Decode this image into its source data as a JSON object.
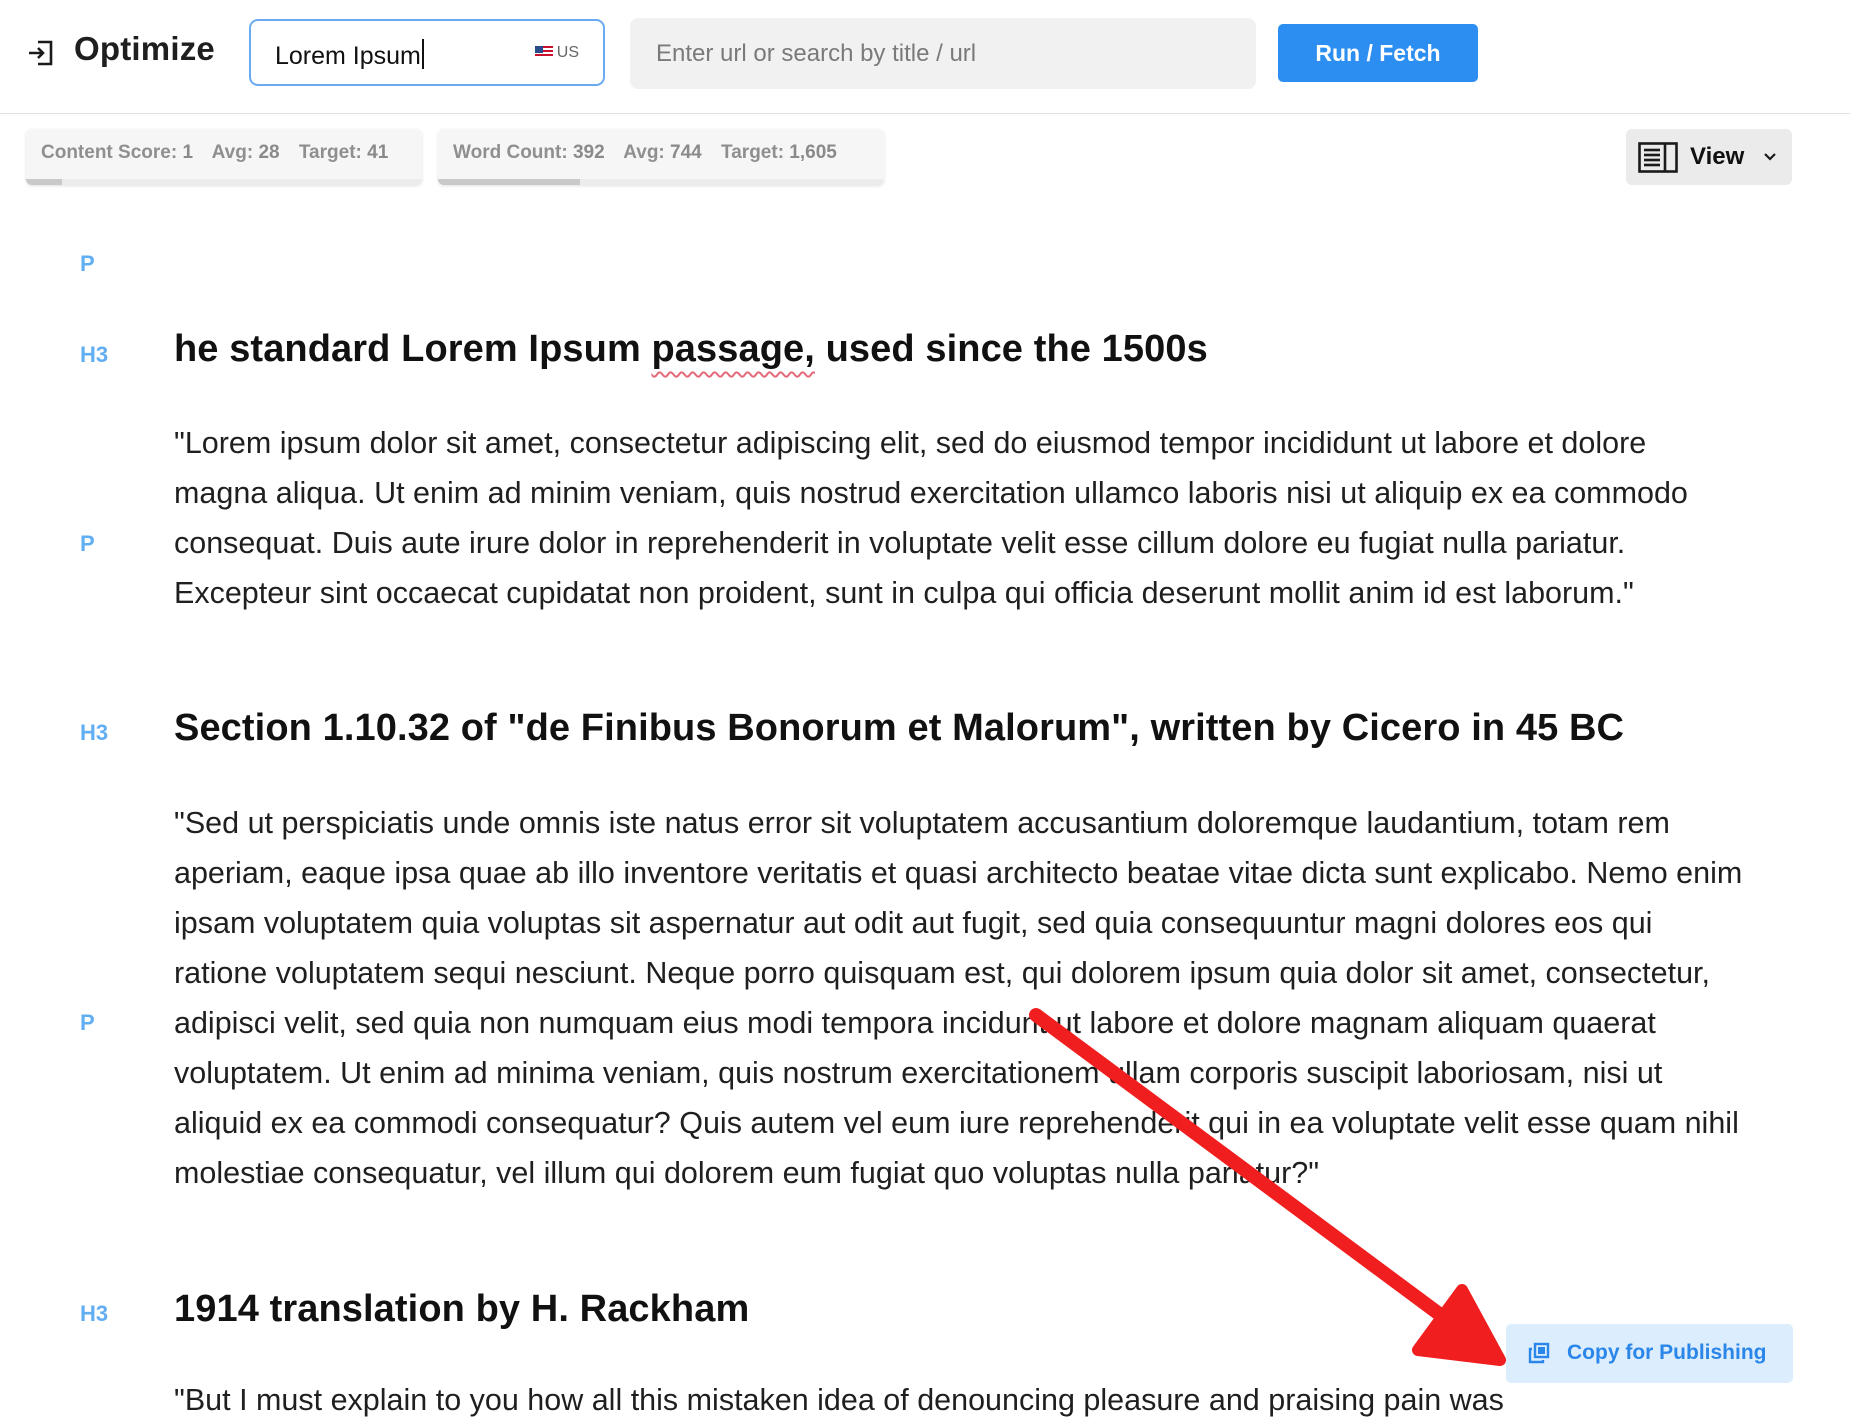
{
  "header": {
    "title": "Optimize",
    "keyword_value": "Lorem Ipsum",
    "locale": "US",
    "url_placeholder": "Enter url or search by title / url",
    "run_label": "Run / Fetch"
  },
  "metrics": {
    "content_score": {
      "label": "Content Score:",
      "value": "1",
      "avg_label": "Avg:",
      "avg": "28",
      "target_label": "Target:",
      "target": "41"
    },
    "word_count": {
      "label": "Word Count:",
      "value": "392",
      "avg_label": "Avg:",
      "avg": "744",
      "target_label": "Target:",
      "target": "1,605"
    },
    "view_label": "View"
  },
  "editor": {
    "blocks": [
      {
        "tag": "P",
        "text": ""
      },
      {
        "tag": "H3",
        "text_before": "he standard Lorem Ipsum ",
        "misspelled": "passage,",
        "text_after": " used since the 1500s"
      },
      {
        "tag": "P",
        "text": "\"Lorem ipsum dolor sit amet, consectetur adipiscing elit, sed do eiusmod tempor incididunt ut labore et dolore magna aliqua. Ut enim ad minim veniam, quis nostrud exercitation ullamco laboris nisi ut aliquip ex ea commodo consequat. Duis aute irure dolor in reprehenderit in voluptate velit esse cillum dolore eu fugiat nulla pariatur. Excepteur sint occaecat cupidatat non proident, sunt in culpa qui officia deserunt mollit anim id est laborum.\""
      },
      {
        "tag": "H3",
        "text": "Section 1.10.32 of \"de Finibus Bonorum et Malorum\", written by Cicero in 45 BC"
      },
      {
        "tag": "P",
        "text": "\"Sed ut perspiciatis unde omnis iste natus error sit voluptatem accusantium doloremque laudantium, totam rem aperiam, eaque ipsa quae ab illo inventore veritatis et quasi architecto beatae vitae dicta sunt explicabo. Nemo enim ipsam voluptatem quia voluptas sit aspernatur aut odit aut fugit, sed quia consequuntur magni dolores eos qui ratione voluptatem sequi nesciunt. Neque porro quisquam est, qui dolorem ipsum quia dolor sit amet, consectetur, adipisci velit, sed quia non numquam eius modi tempora incidunt ut labore et dolore magnam aliquam quaerat voluptatem. Ut enim ad minima veniam, quis nostrum exercitationem ullam corporis suscipit laboriosam, nisi ut aliquid ex ea commodi consequatur? Quis autem vel eum iure reprehenderit qui in ea voluptate velit esse quam nihil molestiae consequatur, vel illum qui dolorem eum fugiat quo voluptas nulla pariatur?\""
      },
      {
        "tag": "H3",
        "text": "1914 translation by H. Rackham"
      },
      {
        "tag": "P",
        "text": "\"But I must explain to you how all this mistaken idea of denouncing pleasure and praising pain was"
      }
    ]
  },
  "copy_label": "Copy for Publishing",
  "colors": {
    "accent": "#2c8ef0",
    "tag": "#62aef2",
    "arrow": "#f01e1e",
    "copy_bg": "#dceefd"
  }
}
